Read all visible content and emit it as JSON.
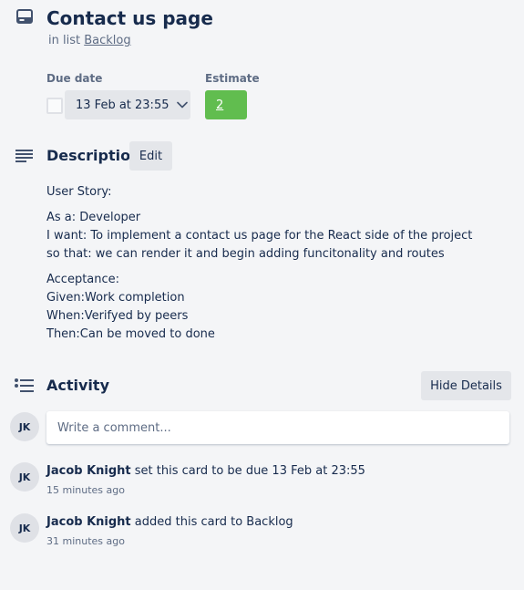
{
  "card": {
    "title": "Contact us page",
    "list_prefix": "in list",
    "list_name": "Backlog"
  },
  "due": {
    "label": "Due date",
    "value": "13 Feb at 23:55",
    "completed": false
  },
  "estimate": {
    "label": "Estimate",
    "value": "2",
    "color": "#61bd4f"
  },
  "description": {
    "heading": "Description",
    "edit_label": "Edit",
    "paragraphs": [
      [
        "User Story:"
      ],
      [
        "As a: Developer",
        "I want: To implement a contact us page for the React side of the project",
        "so that: we can render it and begin adding funcitonality and routes"
      ],
      [
        "Acceptance:",
        "Given:Work completion",
        "When:Verifyed by peers",
        "Then:Can be moved to done"
      ]
    ]
  },
  "activity": {
    "heading": "Activity",
    "hide_details_label": "Hide Details",
    "current_user_initials": "JK",
    "comment_placeholder": "Write a comment...",
    "items": [
      {
        "initials": "JK",
        "user": "Jacob Knight",
        "action": "set this card to be due 13 Feb at 23:55",
        "time": "15 minutes ago"
      },
      {
        "initials": "JK",
        "user": "Jacob Knight",
        "action": "added this card to Backlog",
        "time": "31 minutes ago"
      }
    ]
  },
  "icons": {
    "card_header": "card-icon",
    "description": "description-lines-icon",
    "activity": "activity-list-icon",
    "dropdown": "chevron-down-icon"
  }
}
